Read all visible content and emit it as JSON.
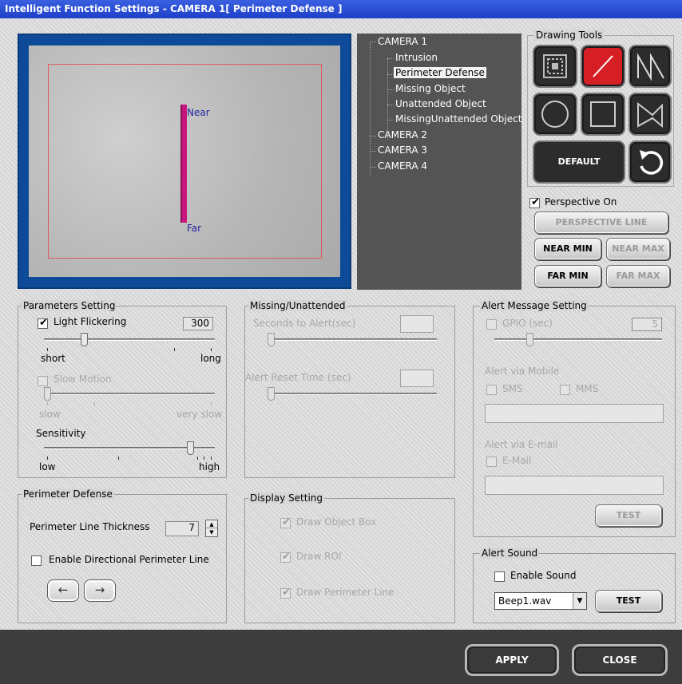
{
  "window": {
    "title": "Intelligent Function Settings - CAMERA 1[ Perimeter Defense ]"
  },
  "preview": {
    "near_label": "Near",
    "far_label": "Far"
  },
  "tree": {
    "cameras": [
      {
        "label": "CAMERA 1",
        "children": [
          "Intrusion",
          "Perimeter Defense",
          "Missing Object",
          "Unattended Object",
          "MissingUnattended Object"
        ]
      },
      {
        "label": "CAMERA 2"
      },
      {
        "label": "CAMERA 3"
      },
      {
        "label": "CAMERA 4"
      }
    ],
    "selected": "Perimeter Defense"
  },
  "drawing_tools": {
    "title": "Drawing Tools",
    "tools": [
      "roi-select-icon",
      "line-icon",
      "polyline-icon",
      "circle-icon",
      "rectangle-icon",
      "polygon-icon",
      "undo-icon"
    ],
    "active_tool": "line-icon",
    "default_label": "DEFAULT",
    "perspective_on_label": "Perspective On",
    "perspective_on_checked": true,
    "perspective_line_label": "PERSPECTIVE LINE",
    "near_min_label": "NEAR MIN",
    "near_max_label": "NEAR MAX",
    "far_min_label": "FAR MIN",
    "far_max_label": "FAR MAX"
  },
  "parameters": {
    "title": "Parameters Setting",
    "light_flickering_label": "Light Flickering",
    "light_flickering_checked": true,
    "light_flickering_value": "300",
    "light_flickering_slider": 0.2,
    "short_label": "short",
    "long_label": "long",
    "slow_motion_label": "Slow Motion",
    "slow_motion_checked": false,
    "slow_motion_slider": 0.0,
    "slow_label": "slow",
    "very_slow_label": "very slow",
    "sensitivity_label": "Sensitivity",
    "sensitivity_slider": 0.86,
    "low_label": "low",
    "high_label": "high"
  },
  "missing": {
    "title": "Missing/Unattended",
    "seconds_label": "Seconds to Alert(sec)",
    "seconds_value": "",
    "reset_label": "Alert Reset Time (sec)",
    "reset_value": ""
  },
  "alert_message": {
    "title": "Alert Message Setting",
    "gpio_label": "GPIO (sec)",
    "gpio_checked": false,
    "gpio_value": "5",
    "gpio_slider": 0.2,
    "mobile_label": "Alert via Mobile",
    "sms_label": "SMS",
    "mms_label": "MMS",
    "mobile_value": "",
    "email_section_label": "Alert via E-mail",
    "email_label": "E-Mail",
    "email_value": "",
    "test_label": "TEST"
  },
  "perimeter": {
    "title": "Perimeter Defense",
    "thickness_label": "Perimeter Line Thickness",
    "thickness_value": "7",
    "directional_label": "Enable Directional Perimeter Line",
    "directional_checked": false,
    "left_arrow": "←",
    "right_arrow": "→"
  },
  "display": {
    "title": "Display Setting",
    "object_box_label": "Draw Object Box",
    "roi_label": "Draw ROI",
    "perimeter_line_label": "Draw Perimeter Line",
    "object_box_checked": true,
    "roi_checked": true,
    "perimeter_line_checked": true
  },
  "alert_sound": {
    "title": "Alert Sound",
    "enable_label": "Enable Sound",
    "enable_checked": false,
    "file_value": "Beep1.wav",
    "test_label": "TEST"
  },
  "footer": {
    "apply_label": "APPLY",
    "close_label": "CLOSE"
  },
  "colors": {
    "title_bar": "#1d40c8",
    "active_tool": "#d51f25",
    "perimeter_line": "#c8157b",
    "roi": "#e05858",
    "video_border": "#0d4a97"
  }
}
